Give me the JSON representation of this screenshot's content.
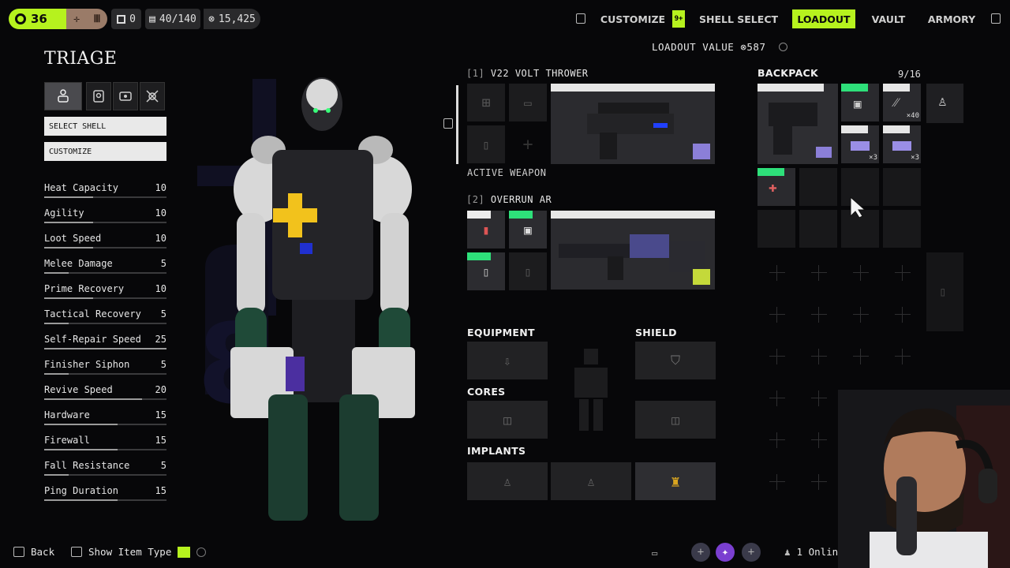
{
  "topbar": {
    "level": "36",
    "inventory_count": "0",
    "capacity": "40/140",
    "currency": "15,425",
    "nav": [
      {
        "label": "CUSTOMIZE"
      },
      {
        "label": "SHELL SELECT"
      },
      {
        "label": "LOADOUT"
      },
      {
        "label": "VAULT"
      },
      {
        "label": "ARMORY"
      }
    ],
    "notif_badge": "9+",
    "active_tab": "LOADOUT"
  },
  "loadout_value": {
    "label": "LOADOUT VALUE",
    "value": "587"
  },
  "shell": {
    "name": "TRIAGE",
    "select_label": "SELECT SHELL",
    "customize_label": "CUSTOMIZE",
    "stats": [
      {
        "label": "Heat Capacity",
        "value": "10",
        "fill": 0.4
      },
      {
        "label": "Agility",
        "value": "10",
        "fill": 0.4
      },
      {
        "label": "Loot Speed",
        "value": "10",
        "fill": 0.4
      },
      {
        "label": "Melee Damage",
        "value": "5",
        "fill": 0.2
      },
      {
        "label": "Prime Recovery",
        "value": "10",
        "fill": 0.4
      },
      {
        "label": "Tactical Recovery",
        "value": "5",
        "fill": 0.2
      },
      {
        "label": "Self-Repair Speed",
        "value": "25",
        "fill": 1.0
      },
      {
        "label": "Finisher Siphon",
        "value": "5",
        "fill": 0.2
      },
      {
        "label": "Revive Speed",
        "value": "20",
        "fill": 0.8
      },
      {
        "label": "Hardware",
        "value": "15",
        "fill": 0.6
      },
      {
        "label": "Firewall",
        "value": "15",
        "fill": 0.6
      },
      {
        "label": "Fall Resistance",
        "value": "5",
        "fill": 0.2
      },
      {
        "label": "Ping Duration",
        "value": "15",
        "fill": 0.6
      }
    ]
  },
  "weapons": {
    "slot1": {
      "index": "[1]",
      "name": "V22 VOLT THROWER",
      "status": "ACTIVE WEAPON"
    },
    "slot2": {
      "index": "[2]",
      "name": "OVERRUN AR"
    }
  },
  "sections": {
    "equipment": "EQUIPMENT",
    "shield": "SHIELD",
    "cores": "CORES",
    "implants": "IMPLANTS"
  },
  "backpack": {
    "title": "BACKPACK",
    "count": "9/16",
    "stack_a": "×40",
    "stack_b": "×3",
    "stack_c": "×3"
  },
  "bottom": {
    "back": "Back",
    "show_item_type": "Show Item Type",
    "online": "1 Onlin"
  },
  "colors": {
    "accent": "#b6f21e",
    "rarity_green": "#2ee07a",
    "background": "#070709"
  }
}
